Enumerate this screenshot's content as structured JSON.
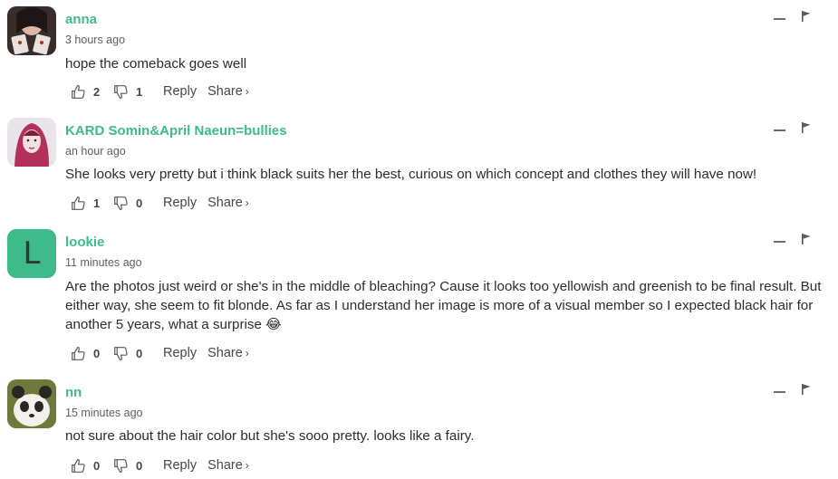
{
  "comments": [
    {
      "username": "anna",
      "time": "3 hours ago",
      "text": "hope the comeback goes well",
      "upvotes": "2",
      "downvotes": "1",
      "reply": "Reply",
      "share": "Share",
      "avatar": "photo"
    },
    {
      "username": "KARD Somin&April Naeun=bullies",
      "time": "an hour ago",
      "text": "She looks very pretty but i think black suits her the best, curious on which concept and clothes they will have now!",
      "upvotes": "1",
      "downvotes": "0",
      "reply": "Reply",
      "share": "Share",
      "avatar": "photo"
    },
    {
      "username": "lookie",
      "time": "11 minutes ago",
      "text": "Are the photos just weird or she's in the middle of bleaching? Cause it looks too yellowish and greenish to be final result. But either way, she seem to fit blonde. As far as I understand her image is more of a visual member so I expected black hair for another 5 years, what a surprise 😂",
      "upvotes": "0",
      "downvotes": "0",
      "reply": "Reply",
      "share": "Share",
      "avatar_letter": "L"
    },
    {
      "username": "nn",
      "time": "15 minutes ago",
      "text": "not sure about the hair color but she's sooo pretty. looks like a fairy.",
      "upvotes": "0",
      "downvotes": "0",
      "reply": "Reply",
      "share": "Share",
      "avatar": "photo"
    }
  ],
  "share_chevron": "›",
  "colors": {
    "accent": "#3fba8a",
    "text": "#2a2e2e",
    "muted": "#5a5f66"
  }
}
